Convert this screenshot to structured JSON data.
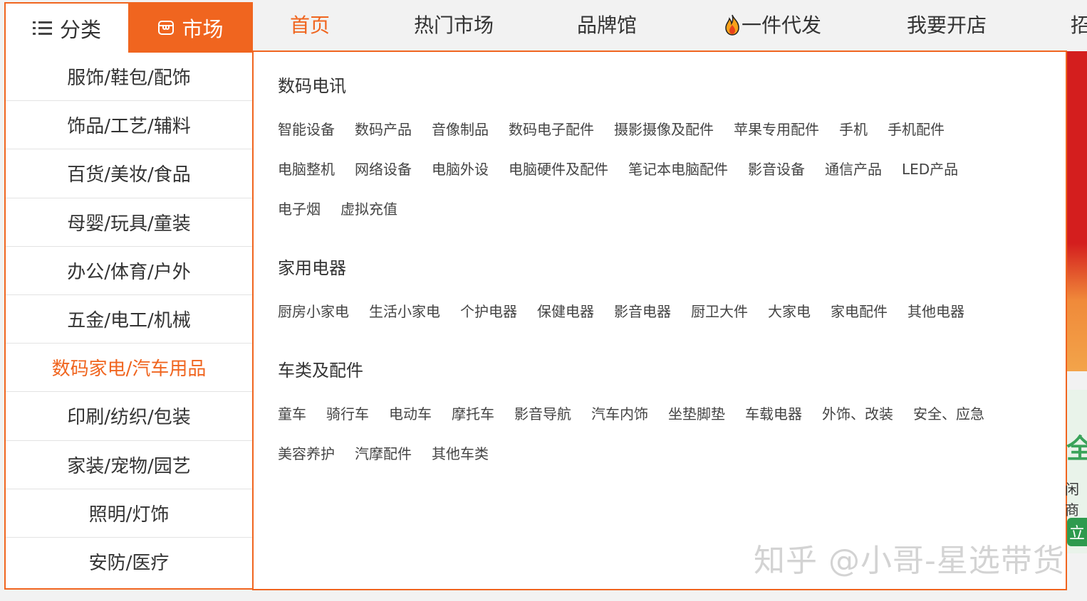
{
  "tabs": {
    "category_label": "分类",
    "market_label": "市场"
  },
  "nav": {
    "items": [
      "首页",
      "热门市场",
      "品牌馆",
      "一件代发",
      "我要开店",
      "招"
    ]
  },
  "sidebar": {
    "items": [
      "服饰/鞋包/配饰",
      "饰品/工艺/辅料",
      "百货/美妆/食品",
      "母婴/玩具/童装",
      "办公/体育/户外",
      "五金/电工/机械",
      "数码家电/汽车用品",
      "印刷/纺织/包装",
      "家装/宠物/园艺",
      "照明/灯饰",
      "安防/医疗"
    ],
    "active_index": 6
  },
  "panel": {
    "sections": [
      {
        "title": "数码电讯",
        "links": [
          "智能设备",
          "数码产品",
          "音像制品",
          "数码电子配件",
          "摄影摄像及配件",
          "苹果专用配件",
          "手机",
          "手机配件",
          "电脑整机",
          "网络设备",
          "电脑外设",
          "电脑硬件及配件",
          "笔记本电脑配件",
          "影音设备",
          "通信产品",
          "LED产品",
          "电子烟",
          "虚拟充值"
        ]
      },
      {
        "title": "家用电器",
        "links": [
          "厨房小家电",
          "生活小家电",
          "个护电器",
          "保健电器",
          "影音电器",
          "厨卫大件",
          "大家电",
          "家电配件",
          "其他电器"
        ]
      },
      {
        "title": "车类及配件",
        "links": [
          "童车",
          "骑行车",
          "电动车",
          "摩托车",
          "影音导航",
          "汽车内饰",
          "坐垫脚垫",
          "车载电器",
          "外饰、改装",
          "安全、应急",
          "美容养护",
          "汽摩配件",
          "其他车类"
        ]
      }
    ]
  },
  "right_banner": {
    "text1": "全",
    "text2": "闲商",
    "button": "立"
  },
  "watermark": "知乎 @小哥-星选带货",
  "colors": {
    "accent": "#f0651f",
    "text": "#333333"
  }
}
